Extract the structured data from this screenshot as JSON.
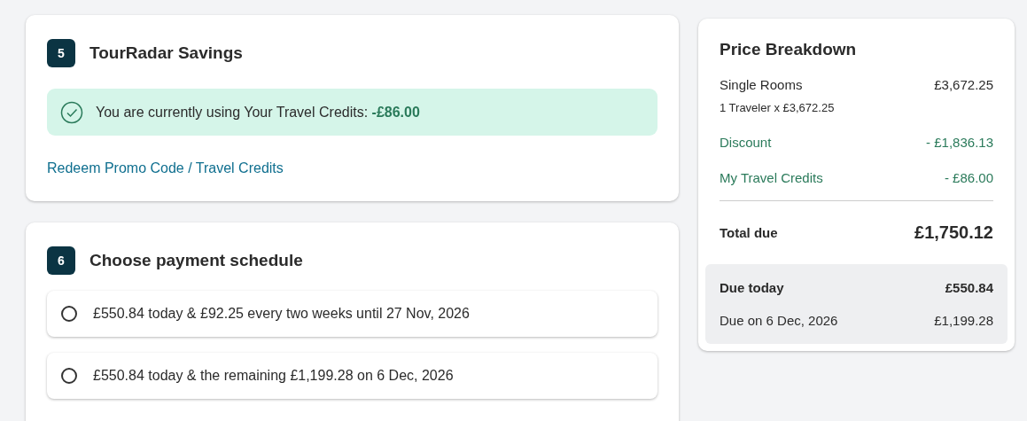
{
  "savings": {
    "step": "5",
    "title": "TourRadar Savings",
    "notice": {
      "text": "You are currently using Your Travel Credits: **-£86.00**"
    },
    "link": "Redeem Promo Code / Travel Credits"
  },
  "schedule": {
    "step": "6",
    "title": "Choose payment schedule",
    "options": [
      {
        "label": "£550.84 today & £92.25 every two weeks until 27 Nov, 2026",
        "selected": false
      },
      {
        "label": "£550.84 today & the remaining £1,199.28 on 6 Dec, 2026",
        "selected": false
      }
    ]
  },
  "price_breakdown": {
    "title": "Price Breakdown",
    "lines": [
      {
        "kind": "item",
        "label": "Single Rooms",
        "amount": "£3,672.25",
        "detail": "1 Traveler x £3,672.25"
      },
      {
        "kind": "deduction",
        "label": "Discount",
        "amount": "- £1,836.13"
      },
      {
        "kind": "deduction",
        "label": "My Travel Credits",
        "amount": "- £86.00"
      }
    ],
    "total": {
      "label": "Total due",
      "amount": "£1,750.12"
    },
    "due": [
      {
        "kind": "today",
        "label": "Due today",
        "amount": "£550.84"
      },
      {
        "kind": "later",
        "label": "Due on 6 Dec, 2026",
        "amount": "£1,199.28"
      }
    ]
  }
}
